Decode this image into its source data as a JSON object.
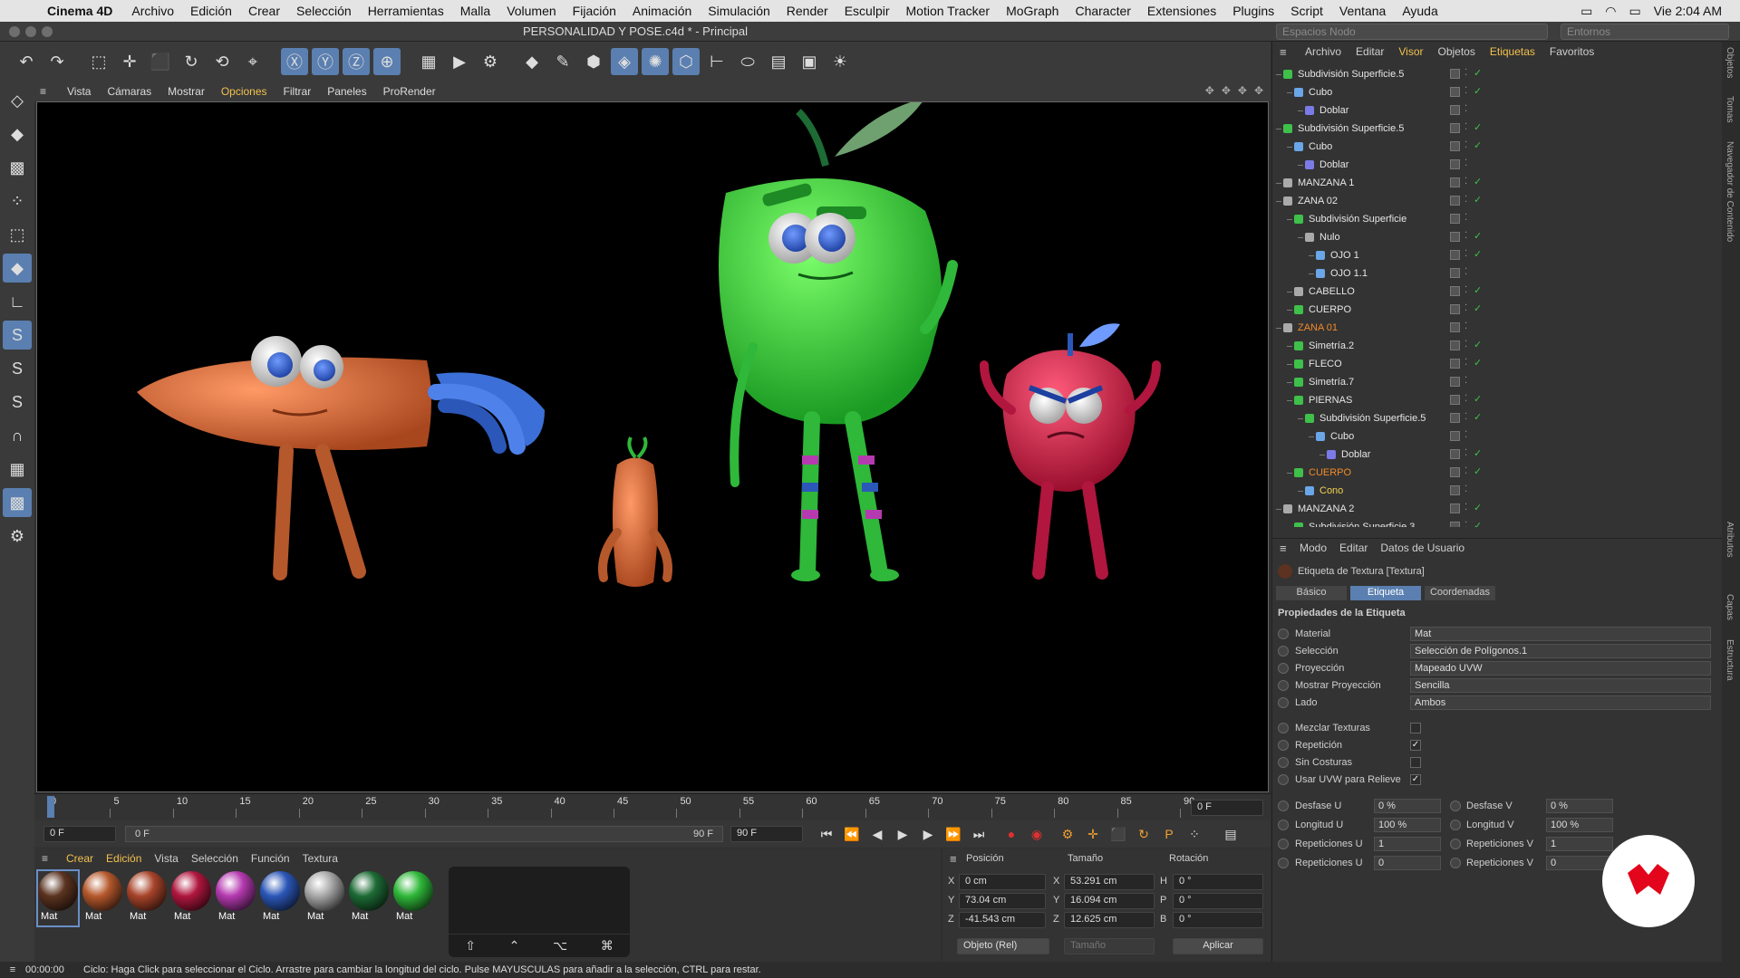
{
  "menubar": {
    "app": "Cinema 4D",
    "items": [
      "Archivo",
      "Edición",
      "Crear",
      "Selección",
      "Herramientas",
      "Malla",
      "Volumen",
      "Fijación",
      "Animación",
      "Simulación",
      "Render",
      "Esculpir",
      "Motion Tracker",
      "MoGraph",
      "Character",
      "Extensiones",
      "Plugins",
      "Script",
      "Ventana",
      "Ayuda"
    ],
    "clock": "Vie 2:04 AM"
  },
  "window": {
    "title": "PERSONALIDAD Y POSE.c4d * - Principal",
    "layout_left": "Espacios Nodo",
    "layout_right": "Entornos"
  },
  "viewport_menu": [
    "Vista",
    "Cámaras",
    "Mostrar",
    "Opciones",
    "Filtrar",
    "Paneles",
    "ProRender"
  ],
  "timeline": {
    "ticks": [
      "0",
      "5",
      "10",
      "15",
      "20",
      "25",
      "30",
      "35",
      "40",
      "45",
      "50",
      "55",
      "60",
      "65",
      "70",
      "75",
      "80",
      "85",
      "90"
    ],
    "current": "0 F",
    "start": "0 F",
    "range_left": "0 F",
    "range_right": "90 F",
    "end": "90 F"
  },
  "materials": {
    "menu": [
      "Crear",
      "Edición",
      "Vista",
      "Selección",
      "Función",
      "Textura"
    ],
    "items": [
      {
        "label": "Mat",
        "color": "#5b3320"
      },
      {
        "label": "Mat",
        "color": "#b5582c"
      },
      {
        "label": "Mat",
        "color": "#a8442a"
      },
      {
        "label": "Mat",
        "color": "#b0163e"
      },
      {
        "label": "Mat",
        "color": "#b53ab0"
      },
      {
        "label": "Mat",
        "color": "#2b57b8"
      },
      {
        "label": "Mat",
        "color": "#a8a8a8"
      },
      {
        "label": "Mat",
        "color": "#1d6b35"
      },
      {
        "label": "Mat",
        "color": "#2fb83a"
      }
    ]
  },
  "coords": {
    "headers": [
      "Posición",
      "Tamaño",
      "Rotación"
    ],
    "rows": [
      {
        "axis": "X",
        "pos": "0 cm",
        "saxis": "X",
        "size": "53.291 cm",
        "raxis": "H",
        "rot": "0 °"
      },
      {
        "axis": "Y",
        "pos": "73.04 cm",
        "saxis": "Y",
        "size": "16.094 cm",
        "raxis": "P",
        "rot": "0 °"
      },
      {
        "axis": "Z",
        "pos": "-41.543 cm",
        "saxis": "Z",
        "size": "12.625 cm",
        "raxis": "B",
        "rot": "0 °"
      }
    ],
    "mode": "Objeto (Rel)",
    "size_mode": "Tamaño",
    "apply": "Aplicar"
  },
  "status": {
    "time": "00:00:00",
    "message": "Ciclo: Haga Click para seleccionar el Ciclo. Arrastre para cambiar la longitud del ciclo. Pulse MAYUSCULAS para añadir a la selección, CTRL para restar."
  },
  "objects": {
    "menu": [
      "Archivo",
      "Editar",
      "Visor",
      "Objetos",
      "Etiquetas",
      "Favoritos"
    ],
    "rows": [
      {
        "name": "Subdivisión Superficie.5",
        "indent": 0,
        "color": "#3ec04a",
        "hl": false
      },
      {
        "name": "Cubo",
        "indent": 1,
        "color": "#6aa6e8",
        "hl": false
      },
      {
        "name": "Doblar",
        "indent": 2,
        "color": "#7b7be8",
        "hl": false
      },
      {
        "name": "Subdivisión Superficie.5",
        "indent": 0,
        "color": "#3ec04a",
        "hl": false
      },
      {
        "name": "Cubo",
        "indent": 1,
        "color": "#6aa6e8",
        "hl": false
      },
      {
        "name": "Doblar",
        "indent": 2,
        "color": "#7b7be8",
        "hl": false
      },
      {
        "name": "MANZANA 1",
        "indent": 0,
        "color": "#aaaaaa",
        "hl": false
      },
      {
        "name": "ZANA 02",
        "indent": 0,
        "color": "#aaaaaa",
        "hl": false
      },
      {
        "name": "Subdivisión Superficie",
        "indent": 1,
        "color": "#3ec04a",
        "hl": false
      },
      {
        "name": "Nulo",
        "indent": 2,
        "color": "#aaaaaa",
        "hl": false
      },
      {
        "name": "OJO 1",
        "indent": 3,
        "color": "#6aa6e8",
        "hl": false
      },
      {
        "name": "OJO 1.1",
        "indent": 3,
        "color": "#6aa6e8",
        "hl": false
      },
      {
        "name": "CABELLO",
        "indent": 1,
        "color": "#aaaaaa",
        "hl": false
      },
      {
        "name": "CUERPO",
        "indent": 1,
        "color": "#3ec04a",
        "hl": false
      },
      {
        "name": "ZANA 01",
        "indent": 0,
        "color": "#aaaaaa",
        "hl": "orange"
      },
      {
        "name": "Simetría.2",
        "indent": 1,
        "color": "#3ec04a",
        "hl": false
      },
      {
        "name": "FLECO",
        "indent": 1,
        "color": "#3ec04a",
        "hl": false
      },
      {
        "name": "Simetría.7",
        "indent": 1,
        "color": "#3ec04a",
        "hl": false
      },
      {
        "name": "PIERNAS",
        "indent": 1,
        "color": "#3ec04a",
        "hl": false
      },
      {
        "name": "Subdivisión Superficie.5",
        "indent": 2,
        "color": "#3ec04a",
        "hl": false
      },
      {
        "name": "Cubo",
        "indent": 3,
        "color": "#6aa6e8",
        "hl": false
      },
      {
        "name": "Doblar",
        "indent": 4,
        "color": "#7b7be8",
        "hl": false
      },
      {
        "name": "CUERPO",
        "indent": 1,
        "color": "#3ec04a",
        "hl": "orange"
      },
      {
        "name": "Cono",
        "indent": 2,
        "color": "#6aa6e8",
        "hl": "yellow"
      },
      {
        "name": "MANZANA 2",
        "indent": 0,
        "color": "#aaaaaa",
        "hl": false
      },
      {
        "name": "Subdivisión Superficie.3",
        "indent": 1,
        "color": "#3ec04a",
        "hl": false
      }
    ]
  },
  "attributes": {
    "menu": [
      "Modo",
      "Editar",
      "Datos de Usuario"
    ],
    "header": "Etiqueta de Textura [Textura]",
    "tabs": [
      "Básico",
      "Etiqueta",
      "Coordenadas"
    ],
    "section": "Propiedades de la Etiqueta",
    "fields": [
      {
        "label": "Material",
        "value": "Mat"
      },
      {
        "label": "Selección",
        "value": "Selección de Polígonos.1"
      },
      {
        "label": "Proyección",
        "value": "Mapeado UVW"
      },
      {
        "label": "Mostrar Proyección",
        "value": "Sencilla"
      },
      {
        "label": "Lado",
        "value": "Ambos"
      }
    ],
    "checks": [
      {
        "label": "Mezclar Texturas",
        "checked": false
      },
      {
        "label": "Repetición",
        "checked": true
      },
      {
        "label": "Sin Costuras",
        "checked": false
      },
      {
        "label": "Usar UVW para Relieve",
        "checked": true
      }
    ],
    "offsets": [
      {
        "l1": "Desfase U",
        "v1": "0 %",
        "l2": "Desfase V",
        "v2": "0 %"
      },
      {
        "l1": "Longitud U",
        "v1": "100 %",
        "l2": "Longitud V",
        "v2": "100 %"
      },
      {
        "l1": "Repeticiones U",
        "v1": "1",
        "l2": "Repeticiones V",
        "v2": "1"
      },
      {
        "l1": "Repeticiones U",
        "v1": "0",
        "l2": "Repeticiones V",
        "v2": "0"
      }
    ]
  },
  "side_tabs": [
    "Objetos",
    "Tomas",
    "Navegador de Contenido",
    "Atributos",
    "Capas",
    "Estructura"
  ]
}
